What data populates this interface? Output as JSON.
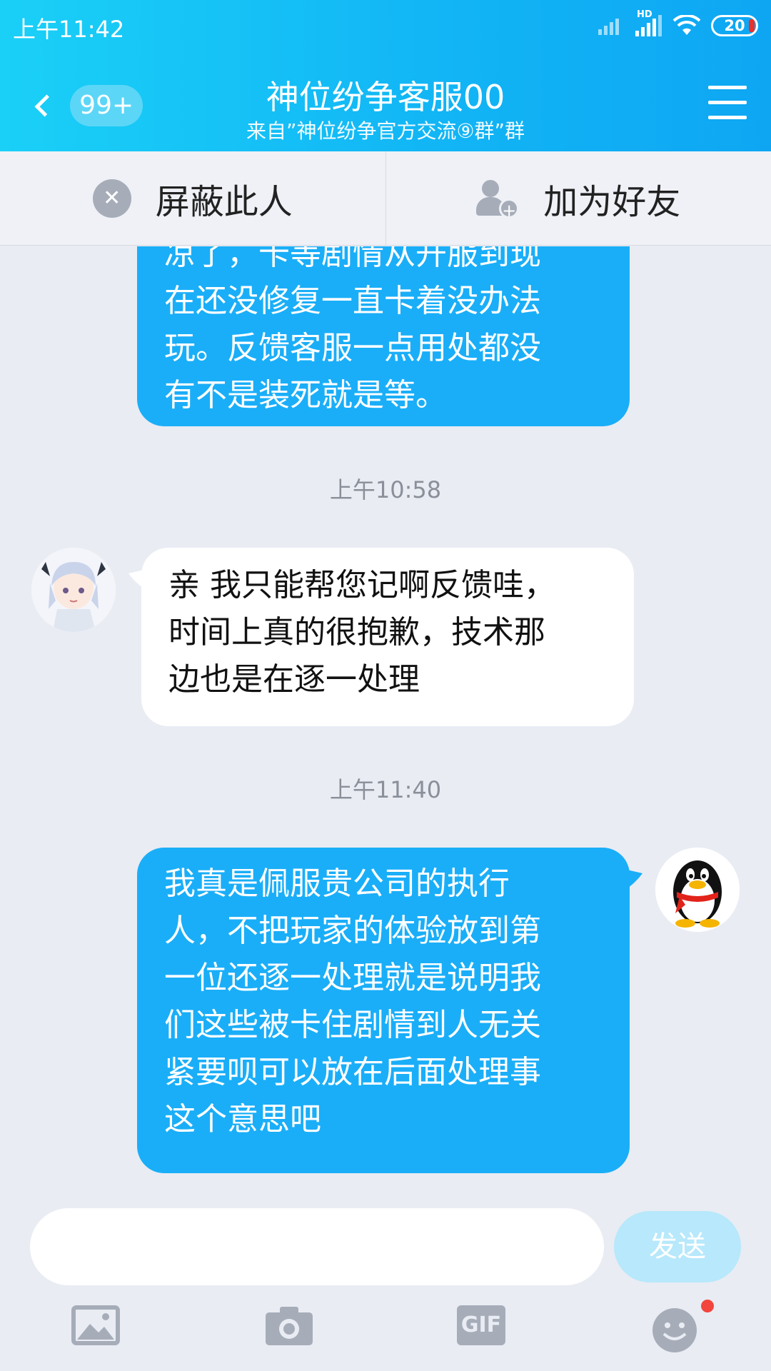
{
  "status_bar": {
    "time": "上午11:42",
    "hd_label": "HD",
    "battery": "20"
  },
  "header": {
    "unread_badge": "99+",
    "title": "神位纷争客服00",
    "subtitle": "来自”神位纷争官方交流⑨群”群"
  },
  "actions": {
    "block_label": "屏蔽此人",
    "add_friend_label": "加为好友"
  },
  "messages": [
    {
      "side": "out",
      "text_lines": [
        "凉了，卡等剧情从开服到现",
        "在还没修复一直卡着没办法",
        "玩。反馈客服一点用处都没",
        "有不是装死就是等。"
      ]
    },
    {
      "time": "上午10:58"
    },
    {
      "side": "in",
      "text_lines": [
        "亲 我只能帮您记啊反馈哇，",
        "时间上真的很抱歉，技术那",
        "边也是在逐一处理"
      ]
    },
    {
      "time": "上午11:40"
    },
    {
      "side": "out",
      "text_lines": [
        "我真是佩服贵公司的执行",
        "人，不把玩家的体验放到第",
        "一位还逐一处理就是说明我",
        "们这些被卡住剧情到人无关",
        "紧要呗可以放在后面处理事",
        "这个意思吧"
      ]
    }
  ],
  "input": {
    "placeholder": "",
    "send_label": "发送"
  },
  "toolbar": {
    "icons": [
      "image-icon",
      "camera-icon",
      "gif-icon",
      "emoji-icon"
    ],
    "gif_label": "GIF"
  },
  "colors": {
    "header_start": "#1ad0f7",
    "header_end": "#0ea6f3",
    "bubble_out": "#1aaef8",
    "send_disabled": "#b7e8fb",
    "notification_dot": "#f2453d"
  }
}
